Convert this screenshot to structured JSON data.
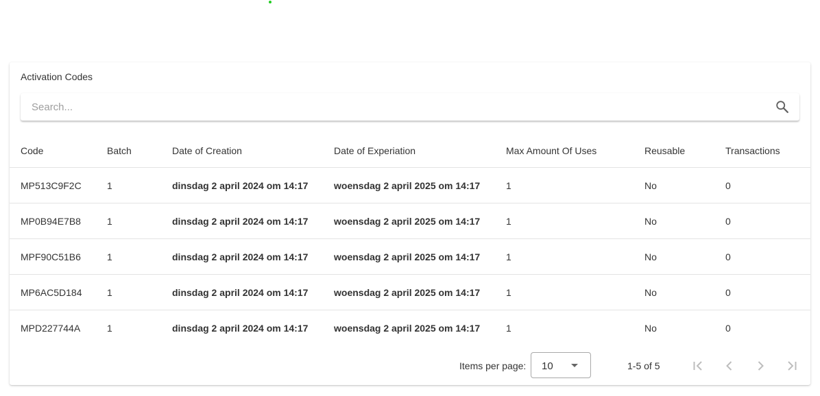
{
  "colors": {
    "status_dot": "#22cc22",
    "disabled_icon": "#bdbdbd"
  },
  "card": {
    "title": "Activation Codes"
  },
  "search": {
    "placeholder": "Search...",
    "icon": "search-icon"
  },
  "table": {
    "headers": [
      "Code",
      "Batch",
      "Date of Creation",
      "Date of Experiation",
      "Max Amount Of Uses",
      "Reusable",
      "Transactions"
    ],
    "rows": [
      [
        "MP513C9F2C",
        "1",
        "dinsdag 2 april 2024 om 14:17",
        "woensdag 2 april 2025 om 14:17",
        "1",
        "No",
        "0"
      ],
      [
        "MP0B94E7B8",
        "1",
        "dinsdag 2 april 2024 om 14:17",
        "woensdag 2 april 2025 om 14:17",
        "1",
        "No",
        "0"
      ],
      [
        "MPF90C51B6",
        "1",
        "dinsdag 2 april 2024 om 14:17",
        "woensdag 2 april 2025 om 14:17",
        "1",
        "No",
        "0"
      ],
      [
        "MP6AC5D184",
        "1",
        "dinsdag 2 april 2024 om 14:17",
        "woensdag 2 april 2025 om 14:17",
        "1",
        "No",
        "0"
      ],
      [
        "MPD227744A",
        "1",
        "dinsdag 2 april 2024 om 14:17",
        "woensdag 2 april 2025 om 14:17",
        "1",
        "No",
        "0"
      ]
    ]
  },
  "paginator": {
    "items_per_page_label": "Items per page:",
    "items_per_page_value": "10",
    "range_label": "1-5 of 5",
    "buttons": [
      "first-page-icon",
      "previous-page-icon",
      "next-page-icon",
      "last-page-icon"
    ]
  }
}
